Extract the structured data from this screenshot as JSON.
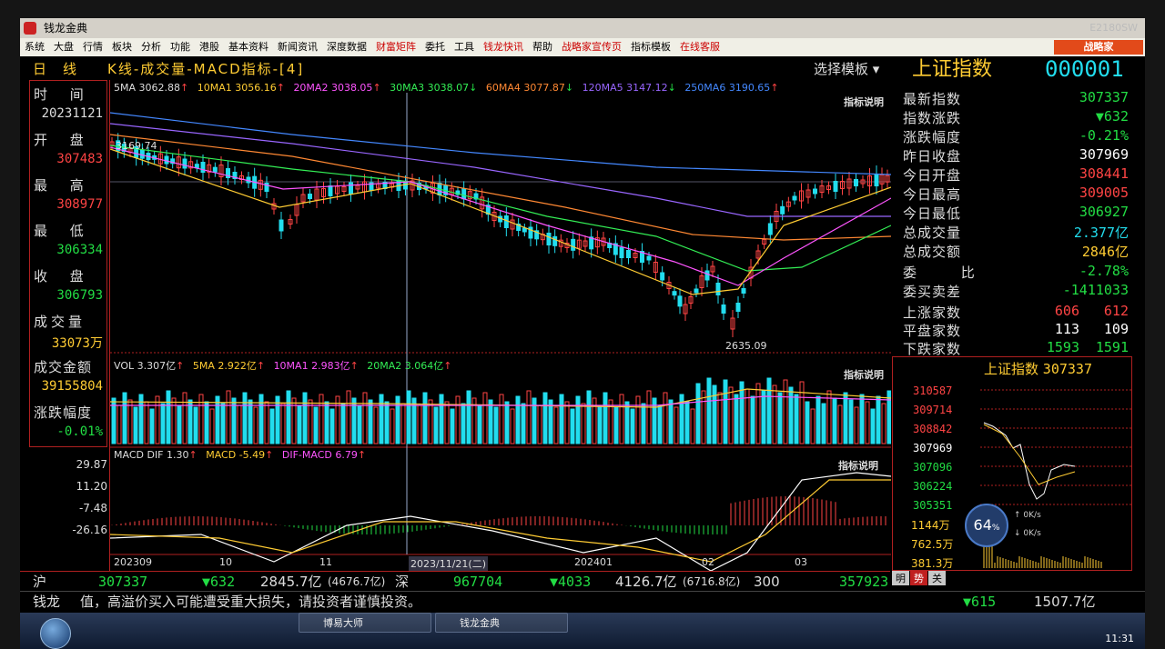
{
  "window": {
    "title": "钱龙金典",
    "code": "E2180SW"
  },
  "menu": [
    "系统",
    "大盘",
    "行情",
    "板块",
    "分析",
    "功能",
    "港股",
    "基本资料",
    "新闻资讯",
    "深度数据"
  ],
  "menu_red": [
    "财富矩阵"
  ],
  "menu2": [
    "委托",
    "工具"
  ],
  "menu_red2": [
    "钱龙快讯"
  ],
  "menu3": [
    "帮助"
  ],
  "menu_red3": [
    "战略家宣传页"
  ],
  "menu4": [
    "指标模板"
  ],
  "menu_red4": [
    "在线客服"
  ],
  "brand_button": "战略家",
  "header": {
    "period": "日线",
    "title": "K线-成交量-MACD指标-[4]",
    "template": "选择模板",
    "index_name": "上证指数",
    "index_code": "000001"
  },
  "left": {
    "time_label": "时 间",
    "date": "20231121",
    "open_label": "开 盘",
    "open": "307483",
    "high_label": "最 高",
    "high": "308977",
    "low_label": "最 低",
    "low": "306334",
    "close_label": "收 盘",
    "close": "306793",
    "vol_label": "成交量",
    "vol": "33073万",
    "amt_label": "成交金额",
    "amt": "39155804",
    "chg_label": "涨跌幅度",
    "chg": "-0.01%"
  },
  "ma_legend": {
    "ma5": "5MA 3062.88",
    "ma10": "10MA1 3056.16",
    "ma20": "20MA2 3038.05",
    "ma30": "30MA3 3038.07",
    "ma60": "60MA4 3077.87",
    "ma120": "120MA5 3147.12",
    "ma250": "250MA6 3190.65",
    "explain": "指标说明"
  },
  "price_marks": {
    "high_mark": "3169.74",
    "low_mark": "2635.09"
  },
  "vol_legend": {
    "vol": "VOL 3.307亿",
    "ma5": "5MA 2.922亿",
    "ma10": "10MA1 2.983亿",
    "ma20": "20MA2 3.064亿",
    "explain": "指标说明"
  },
  "macd_legend": {
    "dif": "MACD DIF 1.30",
    "macd": "MACD -5.49",
    "difmacd": "DIF-MACD 6.79",
    "explain": "指标说明"
  },
  "macd_axis": [
    "29.87",
    "11.20",
    "-7.48",
    "-26.16"
  ],
  "x_axis": [
    "202309",
    "10",
    "11",
    "2023/11/21(二)",
    "202401",
    "02",
    "03"
  ],
  "right": {
    "rows": [
      {
        "label": "最新指数",
        "value": "307337",
        "color": "#22dd44"
      },
      {
        "label": "指数涨跌",
        "value": "▼632",
        "color": "#22dd44"
      },
      {
        "label": "涨跌幅度",
        "value": "-0.21%",
        "color": "#22dd44"
      },
      {
        "label": "昨日收盘",
        "value": "307969",
        "color": "#ffffff"
      },
      {
        "label": "今日开盘",
        "value": "308441",
        "color": "#ff4444"
      },
      {
        "label": "今日最高",
        "value": "309005",
        "color": "#ff4444"
      },
      {
        "label": "今日最低",
        "value": "306927",
        "color": "#22dd44"
      },
      {
        "label": "总成交量",
        "value": "2.377亿",
        "color": "#22ddee"
      },
      {
        "label": "总成交额",
        "value": "2846亿",
        "color": "#ffcc33"
      }
    ],
    "rows2": [
      {
        "label": "委 比",
        "value": "-2.78%",
        "color": "#22dd44"
      },
      {
        "label": "委买卖差",
        "value": "-1411033",
        "color": "#22dd44"
      }
    ],
    "counts": [
      {
        "label": "上涨家数",
        "v1": "606",
        "v2": "612",
        "color": "#ff4444"
      },
      {
        "label": "平盘家数",
        "v1": "113",
        "v2": "109",
        "color": "#ffffff"
      },
      {
        "label": "下跌家数",
        "v1": "1593",
        "v2": "1591",
        "color": "#22dd44"
      }
    ]
  },
  "mini": {
    "title": "上证指数",
    "value": "307337",
    "price_labels": [
      "310587",
      "309714",
      "308842",
      "307969",
      "307096",
      "306224",
      "305351"
    ],
    "vol_labels": [
      "1144万",
      "762.5万",
      "381.3万"
    ],
    "speed": "64",
    "speed_unit": "%",
    "up_rate": "0K/s",
    "down_rate": "0K/s",
    "tabs": [
      "明",
      "势",
      "关"
    ]
  },
  "quotebar": {
    "sh_label": "沪",
    "sh_val": "307337",
    "sh_chg": "▼632",
    "sh_amt": "2845.7亿",
    "sh_amt2": "(4676.7亿)",
    "sz_label": "深",
    "sz_val": "967704",
    "sz_chg": "▼4033",
    "sz_amt": "4126.7亿",
    "sz_amt2": "(6716.8亿)",
    "c300_label": "300",
    "c300_val": "357923",
    "c300_chg": "▼615",
    "c300_amt": "1507.7亿"
  },
  "ticker": {
    "brand": "钱龙",
    "text": "值，高溢价买入可能遭受重大损失，请投资者谨慎投资。"
  },
  "taskbar": {
    "item1": "博易大师",
    "item2": "钱龙金典",
    "time": "11:31"
  },
  "colors": {
    "up": "#ff4444",
    "down": "#22dd44",
    "cyan": "#22ddee",
    "yellow": "#ffcc33",
    "bg": "#000000"
  }
}
